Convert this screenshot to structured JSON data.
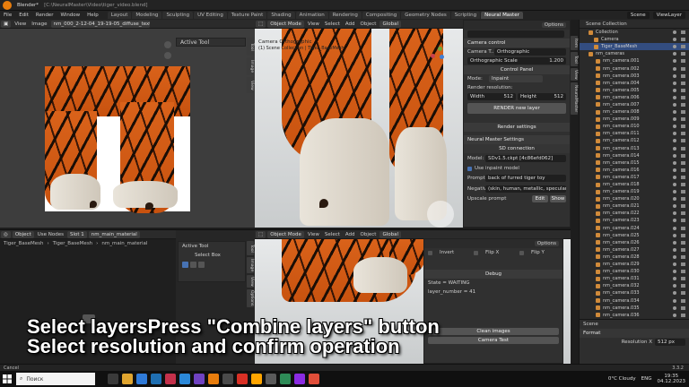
{
  "topbar": {
    "app": "Blender*",
    "path": "[C:\\NeuralMaster\\Video\\tiger_video.blend]",
    "menus": [
      "File",
      "Edit",
      "Render",
      "Window",
      "Help"
    ],
    "tabs": [
      "Layout",
      "Modeling",
      "Sculpting",
      "UV Editing",
      "Texture Paint",
      "Shading",
      "Animation",
      "Rendering",
      "Compositing",
      "Geometry Nodes",
      "Scripting",
      "Neural Master"
    ],
    "active_tab": "Neural Master",
    "scene": "Scene",
    "view_layer": "ViewLayer"
  },
  "image_editor": {
    "view": "View",
    "image": "Image",
    "file": "nm_000_2-12-04_19-19-05_diffuse_textures.png",
    "active_tool": "Active Tool",
    "side_tabs": [
      "Tool",
      "Image",
      "View"
    ]
  },
  "viewport_top": {
    "mode": "Object Mode",
    "menus": [
      "View",
      "Select",
      "Add",
      "Object"
    ],
    "orientation": "Global",
    "camera_label": "Camera Orthographic",
    "camera_sub": "(1) Scene Collection | Tiger_BaseMesh",
    "options": "Options"
  },
  "nm_panel": {
    "camera_control": "Camera control",
    "camera_type_label": "Camera T...",
    "camera_type": "Orthographic",
    "ortho_scale_label": "Orthographic Scale",
    "ortho_scale": "1.200",
    "control_panel": "Control Panel",
    "mode_label": "Mode:",
    "mode": "Inpaint",
    "render_resolution": "Render resolution:",
    "width_label": "Width",
    "width": "512",
    "height_label": "Height",
    "height": "512",
    "render_new_layer": "RENDER new layer",
    "render_settings": "Render settings",
    "settings_header": "Neural Master Settings",
    "sd_connection": "SD connection",
    "model_label": "Model:",
    "model": "SDv1.5.ckpt [4c86efd062]",
    "use_inpaint": "Use inpaint model",
    "prompt_label": "Prompt:",
    "prompt": "back of furred tiger toy",
    "negative_label": "Negative:",
    "negative": "(skin, human, metallic, specular, refl...",
    "upscale_label": "Upscale prompt",
    "edit": "Edit",
    "show": "Show",
    "side_tabs": [
      "Item",
      "Tool",
      "View",
      "NeuralMaster"
    ]
  },
  "outliner": {
    "title": "Scene Collection",
    "items": [
      "Collection",
      "Camera",
      "Tiger_BaseMesh",
      "nm_cameras",
      "nm_camera.001",
      "nm_camera.002",
      "nm_camera.003",
      "nm_camera.004",
      "nm_camera.005",
      "nm_camera.006",
      "nm_camera.007",
      "nm_camera.008",
      "nm_camera.009",
      "nm_camera.010",
      "nm_camera.011",
      "nm_camera.012",
      "nm_camera.013",
      "nm_camera.014",
      "nm_camera.015",
      "nm_camera.016",
      "nm_camera.017",
      "nm_camera.018",
      "nm_camera.019",
      "nm_camera.020",
      "nm_camera.021",
      "nm_camera.022",
      "nm_camera.023",
      "nm_camera.024",
      "nm_camera.025",
      "nm_camera.026",
      "nm_camera.027",
      "nm_camera.028",
      "nm_camera.029",
      "nm_camera.030",
      "nm_camera.031",
      "nm_camera.032",
      "nm_camera.033",
      "nm_camera.034",
      "nm_camera.035",
      "nm_camera.036"
    ],
    "props_scene": "Scene",
    "format": "Format",
    "resolution_label": "Resolution X",
    "resolution_x": "512 px"
  },
  "node_editor": {
    "object": "Object",
    "use_nodes": "Use Nodes",
    "slot": "Slot 1",
    "material": "nm_main_material",
    "breadcrumb": [
      "Tiger_BaseMesh",
      "Tiger_BaseMesh",
      "nm_main_material"
    ]
  },
  "tool_panel_bottom": {
    "active_tool": "Active Tool",
    "select_box": "Select Box",
    "side_tabs": [
      "Tool",
      "Image",
      "View",
      "Options"
    ]
  },
  "viewport_bottom": {
    "mode": "Object Mode",
    "menus": [
      "View",
      "Select",
      "Add",
      "Object"
    ],
    "orientation": "Global",
    "options": "Options",
    "invert": "Invert",
    "flip_x": "Flip X",
    "flip_y": "Flip Y",
    "debug": "Debug",
    "state": "State = WAITING",
    "layer_number": "layer_number = 41",
    "clean_images": "Clean images",
    "camera_test": "Camera Test"
  },
  "caption": {
    "line1": "Select layersPress \"Combine layers\" button",
    "line2": "Select resolution and confirm operation"
  },
  "statusbar": {
    "left": "Cancel",
    "right": "3.3.2"
  },
  "taskbar": {
    "search": "Поиск",
    "weather": "0°C  Cloudy",
    "lang": "ENG",
    "time": "19:35",
    "date": "04.12.2023"
  },
  "colors": {
    "accent": "#e87d0d",
    "panel_bg": "#303030",
    "header_bg": "#2b2b2b"
  }
}
